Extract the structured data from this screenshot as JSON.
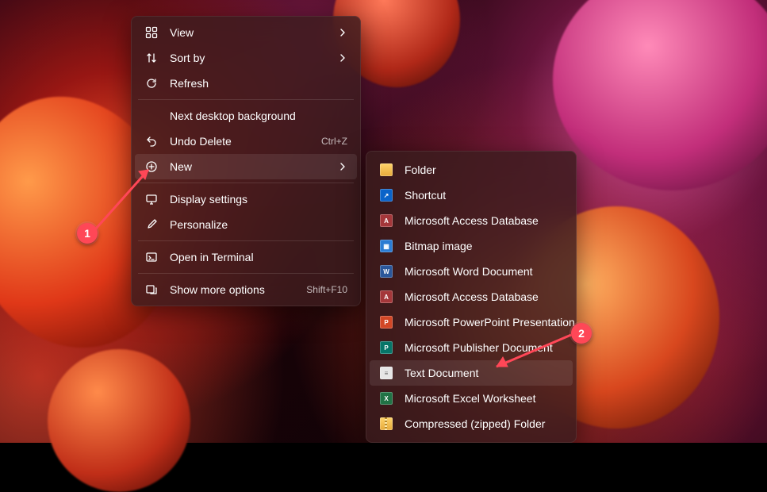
{
  "desktop_menu": {
    "items": [
      {
        "label": "View",
        "has_submenu": true
      },
      {
        "label": "Sort by",
        "has_submenu": true
      },
      {
        "label": "Refresh"
      }
    ],
    "group2": [
      {
        "label": "Next desktop background",
        "no_icon": true
      },
      {
        "label": "Undo Delete",
        "accel": "Ctrl+Z"
      },
      {
        "label": "New",
        "has_submenu": true,
        "highlighted": true
      }
    ],
    "group3": [
      {
        "label": "Display settings"
      },
      {
        "label": "Personalize"
      }
    ],
    "group4": [
      {
        "label": "Open in Terminal"
      }
    ],
    "group5": [
      {
        "label": "Show more options",
        "accel": "Shift+F10"
      }
    ]
  },
  "new_submenu": {
    "items": [
      {
        "label": "Folder",
        "icon": "folder"
      },
      {
        "label": "Shortcut",
        "icon": "shortcut"
      },
      {
        "label": "Microsoft Access Database",
        "icon": "access"
      },
      {
        "label": "Bitmap image",
        "icon": "bmp"
      },
      {
        "label": "Microsoft Word Document",
        "icon": "word"
      },
      {
        "label": "Microsoft Access Database",
        "icon": "access"
      },
      {
        "label": "Microsoft PowerPoint Presentation",
        "icon": "ppt"
      },
      {
        "label": "Microsoft Publisher Document",
        "icon": "pub"
      },
      {
        "label": "Text Document",
        "icon": "txt",
        "highlighted": true
      },
      {
        "label": "Microsoft Excel Worksheet",
        "icon": "xls"
      },
      {
        "label": "Compressed (zipped) Folder",
        "icon": "zip"
      }
    ]
  },
  "annotations": {
    "callout1": "1",
    "callout2": "2"
  }
}
